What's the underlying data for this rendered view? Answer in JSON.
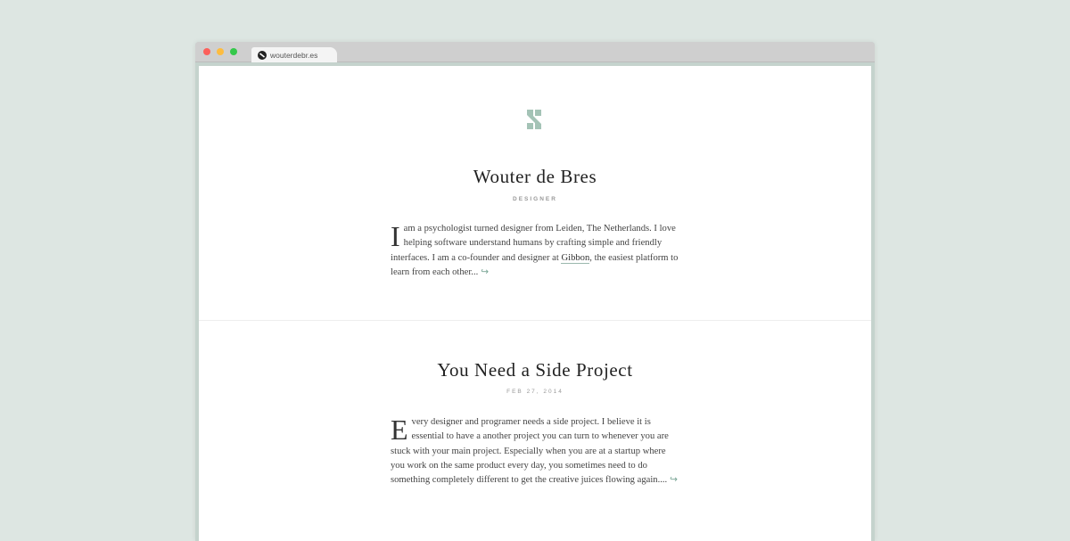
{
  "browser": {
    "tab_title": "wouterdebr.es",
    "tab_icon": "site-logo-icon"
  },
  "header": {
    "logo_icon": "site-logo-icon",
    "logo_color": "#a4c3b6",
    "name": "Wouter de Bres",
    "role": "DESIGNER"
  },
  "bio": {
    "dropcap": "I",
    "text_before_link": " am a psychologist turned designer from Leiden, The Netherlands. I love helping software understand humans by crafting simple and friendly interfaces. I am a co-founder and designer at ",
    "link_text": "Gibbon",
    "text_after_link": ", the easiest platform to learn from each other...",
    "more_icon": "return-arrow-icon"
  },
  "post": {
    "title": "You Need a Side Project",
    "date": "FEB 27, 2014",
    "dropcap": "E",
    "text": "very designer and programer needs a side project. I believe it is essential to have a another project you can turn to whenever you are stuck with your main project. Especially when you are at a startup where you work on the same product every day, you sometimes need to do something completely different to get the creative juices flowing again....",
    "more_icon": "return-arrow-icon"
  },
  "colors": {
    "background": "#dde6e2",
    "accent": "#a4c3b6",
    "window_frame": "#c5d3cd"
  }
}
